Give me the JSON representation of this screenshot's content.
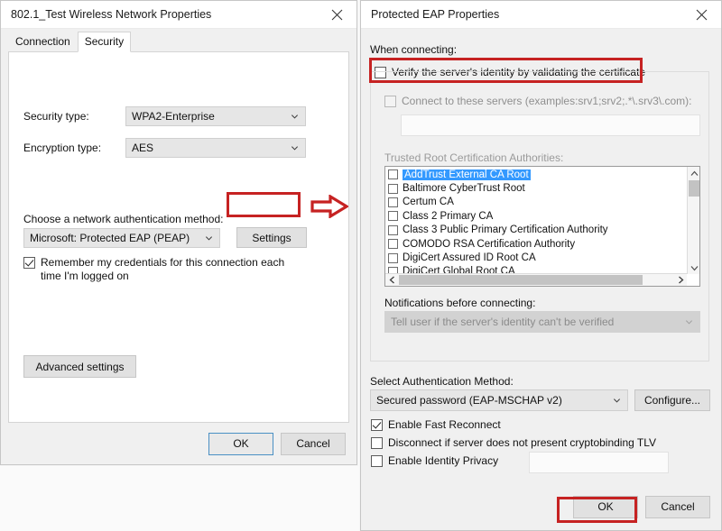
{
  "left_dialog": {
    "title": "802.1_Test Wireless Network Properties",
    "close_icon": "close-icon",
    "tabs": [
      {
        "label": "Connection",
        "active": false
      },
      {
        "label": "Security",
        "active": true
      }
    ],
    "fields": {
      "security_type_label": "Security type:",
      "security_type_value": "WPA2-Enterprise",
      "encryption_type_label": "Encryption type:",
      "encryption_type_value": "AES",
      "auth_method_label": "Choose a network authentication method:",
      "auth_method_value": "Microsoft: Protected EAP (PEAP)"
    },
    "settings_button": "Settings",
    "remember_checkbox": {
      "checked": true,
      "line1": "Remember my credentials for this connection each",
      "line2": "time I'm logged on"
    },
    "advanced_button": "Advanced settings",
    "ok_button": "OK",
    "cancel_button": "Cancel"
  },
  "right_dialog": {
    "title": "Protected EAP Properties",
    "close_icon": "close-icon",
    "when_connecting_label": "When connecting:",
    "verify_checkbox": {
      "checked": false,
      "label": "Verify the server's identity by validating the certificate"
    },
    "connect_servers_checkbox": {
      "checked": false,
      "label": "Connect to these servers (examples:srv1;srv2;.*\\.srv3\\.com):"
    },
    "servers_input_value": "",
    "trusted_roots_label": "Trusted Root Certification Authorities:",
    "trusted_roots": [
      {
        "name": "AddTrust External CA Root",
        "checked": false,
        "selected": true
      },
      {
        "name": "Baltimore CyberTrust Root",
        "checked": false,
        "selected": false
      },
      {
        "name": "Certum CA",
        "checked": false,
        "selected": false
      },
      {
        "name": "Class 2 Primary CA",
        "checked": false,
        "selected": false
      },
      {
        "name": "Class 3 Public Primary Certification Authority",
        "checked": false,
        "selected": false
      },
      {
        "name": "COMODO RSA Certification Authority",
        "checked": false,
        "selected": false
      },
      {
        "name": "DigiCert Assured ID Root CA",
        "checked": false,
        "selected": false
      },
      {
        "name": "DigiCert Global Root CA",
        "checked": false,
        "selected": false
      }
    ],
    "notifications_label": "Notifications before connecting:",
    "notifications_value": "Tell user if the server's identity can't be verified",
    "auth_method_label": "Select Authentication Method:",
    "auth_method_value": "Secured password (EAP-MSCHAP v2)",
    "configure_button": "Configure...",
    "checkboxes": [
      {
        "label": "Enable Fast Reconnect",
        "checked": true
      },
      {
        "label": "Disconnect if server does not present cryptobinding TLV",
        "checked": false
      },
      {
        "label": "Enable Identity Privacy",
        "checked": false
      }
    ],
    "identity_privacy_value": "",
    "ok_button": "OK",
    "cancel_button": "Cancel"
  },
  "annotations": {
    "highlight_color": "#c62222",
    "arrow_icon": "right-arrow-icon",
    "boxes": [
      "settings-button",
      "verify-certificate-checkbox",
      "right-ok-button"
    ]
  }
}
